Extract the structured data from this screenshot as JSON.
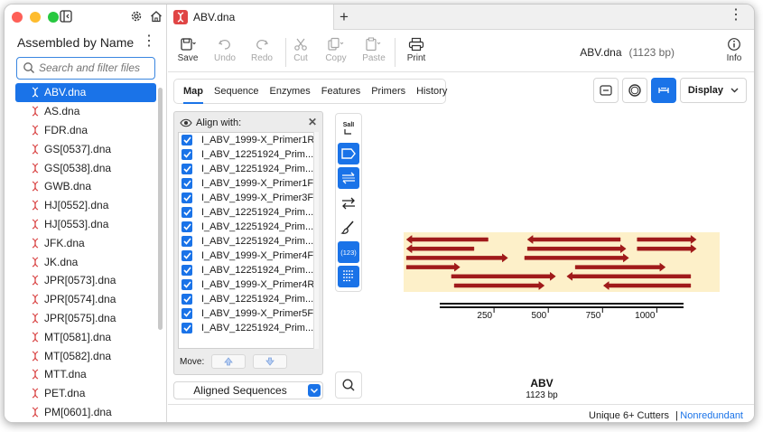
{
  "sidebar": {
    "title": "Assembled by Name",
    "search_placeholder": "Search and filter files",
    "files": [
      {
        "name": "ABV.dna",
        "active": true
      },
      {
        "name": "AS.dna"
      },
      {
        "name": "FDR.dna"
      },
      {
        "name": "GS[0537].dna"
      },
      {
        "name": "GS[0538].dna"
      },
      {
        "name": "GWB.dna"
      },
      {
        "name": "HJ[0552].dna"
      },
      {
        "name": "HJ[0553].dna"
      },
      {
        "name": "JFK.dna"
      },
      {
        "name": "JK.dna"
      },
      {
        "name": "JPR[0573].dna"
      },
      {
        "name": "JPR[0574].dna"
      },
      {
        "name": "JPR[0575].dna"
      },
      {
        "name": "MT[0581].dna"
      },
      {
        "name": "MT[0582].dna"
      },
      {
        "name": "MTT.dna"
      },
      {
        "name": "PET.dna"
      },
      {
        "name": "PM[0601].dna"
      }
    ]
  },
  "tab": {
    "title": "ABV.dna"
  },
  "toolbar": {
    "save": "Save",
    "undo": "Undo",
    "redo": "Redo",
    "cut": "Cut",
    "copy": "Copy",
    "paste": "Paste",
    "print": "Print",
    "info": "Info"
  },
  "document": {
    "name": "ABV.dna",
    "length": "(1123 bp)"
  },
  "view_tabs": [
    "Map",
    "Sequence",
    "Enzymes",
    "Features",
    "Primers",
    "History"
  ],
  "display_label": "Display",
  "align_panel": {
    "title": "Align with:",
    "items": [
      "I_ABV_1999-X_Primer1R",
      "I_ABV_12251924_Prim...",
      "I_ABV_12251924_Prim...",
      "I_ABV_1999-X_Primer1F",
      "I_ABV_1999-X_Primer3F",
      "I_ABV_12251924_Prim...",
      "I_ABV_12251924_Prim...",
      "I_ABV_12251924_Prim...",
      "I_ABV_1999-X_Primer4F",
      "I_ABV_12251924_Prim...",
      "I_ABV_1999-X_Primer4R",
      "I_ABV_12251924_Prim...",
      "I_ABV_1999-X_Primer5F",
      "I_ABV_12251924_Prim..."
    ],
    "move_label": "Move:"
  },
  "aligned_dropdown": "Aligned Sequences",
  "vtools": {
    "sali_label": "SalI",
    "numbers_label": "(123)"
  },
  "map": {
    "name": "ABV",
    "length_label": "1123 bp",
    "ticks": [
      "250",
      "500",
      "750",
      "1000"
    ],
    "sequence_length": 1123,
    "tick_values": [
      250,
      500,
      750,
      1000
    ],
    "alignments": [
      {
        "row": 0,
        "start": 10,
        "end": 300,
        "dir": "rev"
      },
      {
        "row": 0,
        "start": 440,
        "end": 770,
        "dir": "rev"
      },
      {
        "row": 0,
        "start": 830,
        "end": 1040,
        "dir": "fwd"
      },
      {
        "row": 1,
        "start": 10,
        "end": 250,
        "dir": "rev"
      },
      {
        "row": 1,
        "start": 440,
        "end": 790,
        "dir": "fwd"
      },
      {
        "row": 1,
        "start": 830,
        "end": 1040,
        "dir": "fwd"
      },
      {
        "row": 2,
        "start": 10,
        "end": 370,
        "dir": "fwd"
      },
      {
        "row": 2,
        "start": 430,
        "end": 800,
        "dir": "fwd"
      },
      {
        "row": 3,
        "start": 10,
        "end": 200,
        "dir": "fwd"
      },
      {
        "row": 3,
        "start": 610,
        "end": 930,
        "dir": "fwd"
      },
      {
        "row": 4,
        "start": 170,
        "end": 540,
        "dir": "fwd"
      },
      {
        "row": 4,
        "start": 580,
        "end": 1020,
        "dir": "rev"
      },
      {
        "row": 5,
        "start": 180,
        "end": 500,
        "dir": "fwd"
      },
      {
        "row": 5,
        "start": 710,
        "end": 1020,
        "dir": "rev"
      }
    ]
  },
  "status": {
    "cutters": "Unique 6+ Cutters",
    "separator": "|",
    "mode": "Nonredundant"
  }
}
